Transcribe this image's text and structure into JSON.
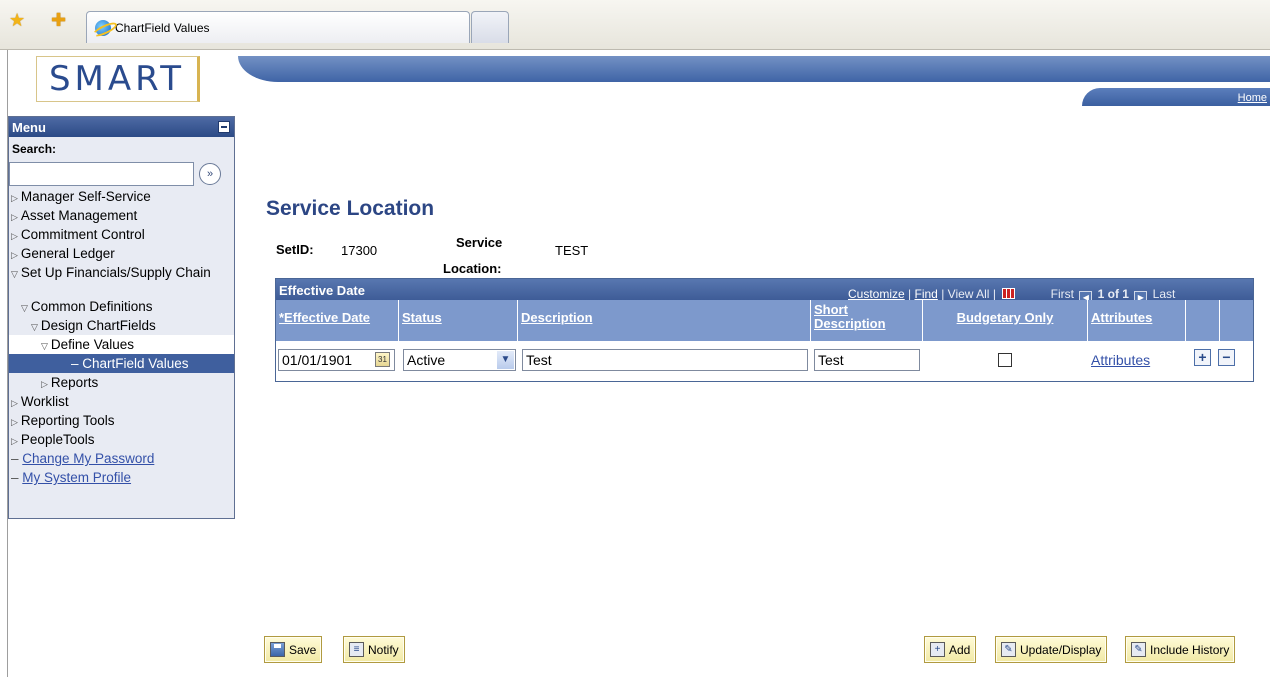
{
  "browser": {
    "tab_title": "ChartField Values",
    "favorites_star": "☆",
    "add_favorites_star": "☆"
  },
  "header": {
    "logo_text": "SMART",
    "home_link": "Home"
  },
  "menu": {
    "title": "Menu",
    "search_label": "Search:",
    "search_value": "",
    "search_go": "»",
    "items": [
      {
        "label": "Manager Self-Service",
        "expanded": false
      },
      {
        "label": "Asset Management",
        "expanded": false
      },
      {
        "label": "Commitment Control",
        "expanded": false
      },
      {
        "label": "General Ledger",
        "expanded": false
      },
      {
        "label": "Set Up Financials/Supply Chain",
        "expanded": true
      },
      {
        "label": "Common Definitions",
        "expanded": true
      },
      {
        "label": "Design ChartFields",
        "expanded": true
      },
      {
        "label": "Define Values",
        "expanded": true
      },
      {
        "label": "– ChartField Values",
        "selected": true
      },
      {
        "label": "Reports",
        "expanded": false
      },
      {
        "label": "Worklist",
        "expanded": false
      },
      {
        "label": "Reporting Tools",
        "expanded": false
      },
      {
        "label": "PeopleTools",
        "expanded": false
      },
      {
        "label": "Change My Password"
      },
      {
        "label": "My System Profile"
      }
    ]
  },
  "page": {
    "title": "Service Location",
    "setid_label": "SetID:",
    "setid_value": "17300",
    "service_location_label_line1": "Service",
    "service_location_label_line2": "Location:",
    "service_location_value": "TEST"
  },
  "grid": {
    "title": "Effective Date",
    "customize": "Customize",
    "find": "Find",
    "view_all": "View All",
    "sep": "|",
    "first": "First",
    "count": "1 of 1",
    "last": "Last",
    "columns": {
      "effective_date": "*Effective Date",
      "status": "Status",
      "description": "Description",
      "short_description_line1": "Short",
      "short_description_line2": "Description",
      "budgetary_only": "Budgetary Only",
      "attributes": "Attributes"
    },
    "row": {
      "effective_date": "01/01/1901",
      "status": "Active",
      "description": "Test",
      "short_description": "Test",
      "budgetary_only": false,
      "attributes_link": "Attributes",
      "add_row": "+",
      "delete_row": "−"
    }
  },
  "buttons": {
    "save": "Save",
    "notify": "Notify",
    "add": "Add",
    "update_display": "Update/Display",
    "include_history": "Include History"
  }
}
